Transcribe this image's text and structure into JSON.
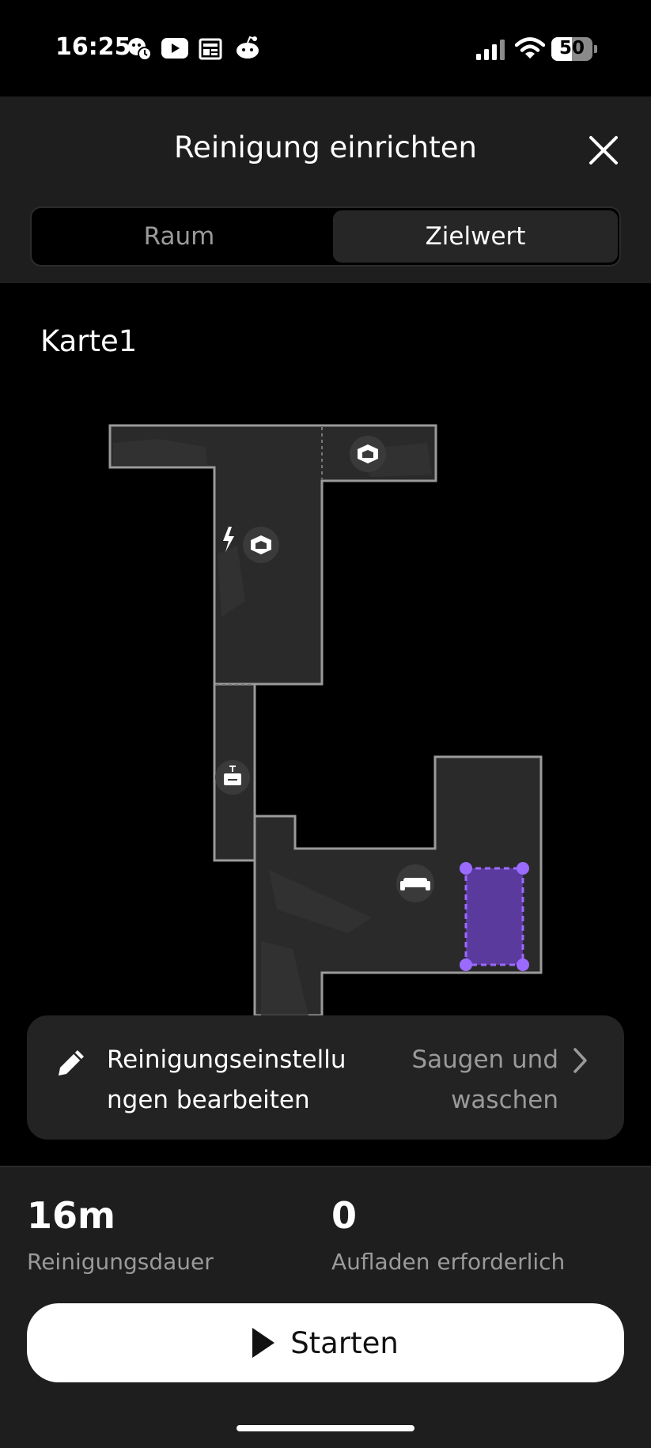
{
  "status_bar": {
    "time": "16:25",
    "battery": "50",
    "left_icons": [
      "monkey-alarm-icon",
      "youtube-icon",
      "news-icon",
      "reddit-icon"
    ],
    "right_icons": [
      "signal-icon",
      "wifi-icon",
      "battery-icon"
    ]
  },
  "header": {
    "title": "Reinigung einrichten",
    "close_icon": "close-icon"
  },
  "tabs": [
    {
      "label": "Raum",
      "selected": false
    },
    {
      "label": "Zielwert",
      "selected": true
    }
  ],
  "map": {
    "label": "Karte1",
    "icons": [
      "room-cube-icon",
      "charging-icon",
      "room-cube-icon",
      "nightstand-icon",
      "sofa-icon"
    ],
    "target_zone_color": "#5b3a9e",
    "target_zone_border": "#9b6bff"
  },
  "settings": {
    "label": "Reinigungseinstellungen bearbeiten",
    "label_line1": "Reinigungseinstellu",
    "label_line2": "ngen bearbeiten",
    "value_line1": "Saugen und",
    "value_line2": "waschen"
  },
  "summary": {
    "duration_value": "16m",
    "duration_label": "Reinigungsdauer",
    "recharge_value": "0",
    "recharge_label": "Aufladen erforderlich"
  },
  "start_button": {
    "label": "Starten"
  },
  "colors": {
    "background": "#000000",
    "panel": "#1e1e1e",
    "card": "#232323",
    "accent": "#9b6bff",
    "muted_text": "#9a9a9a"
  }
}
